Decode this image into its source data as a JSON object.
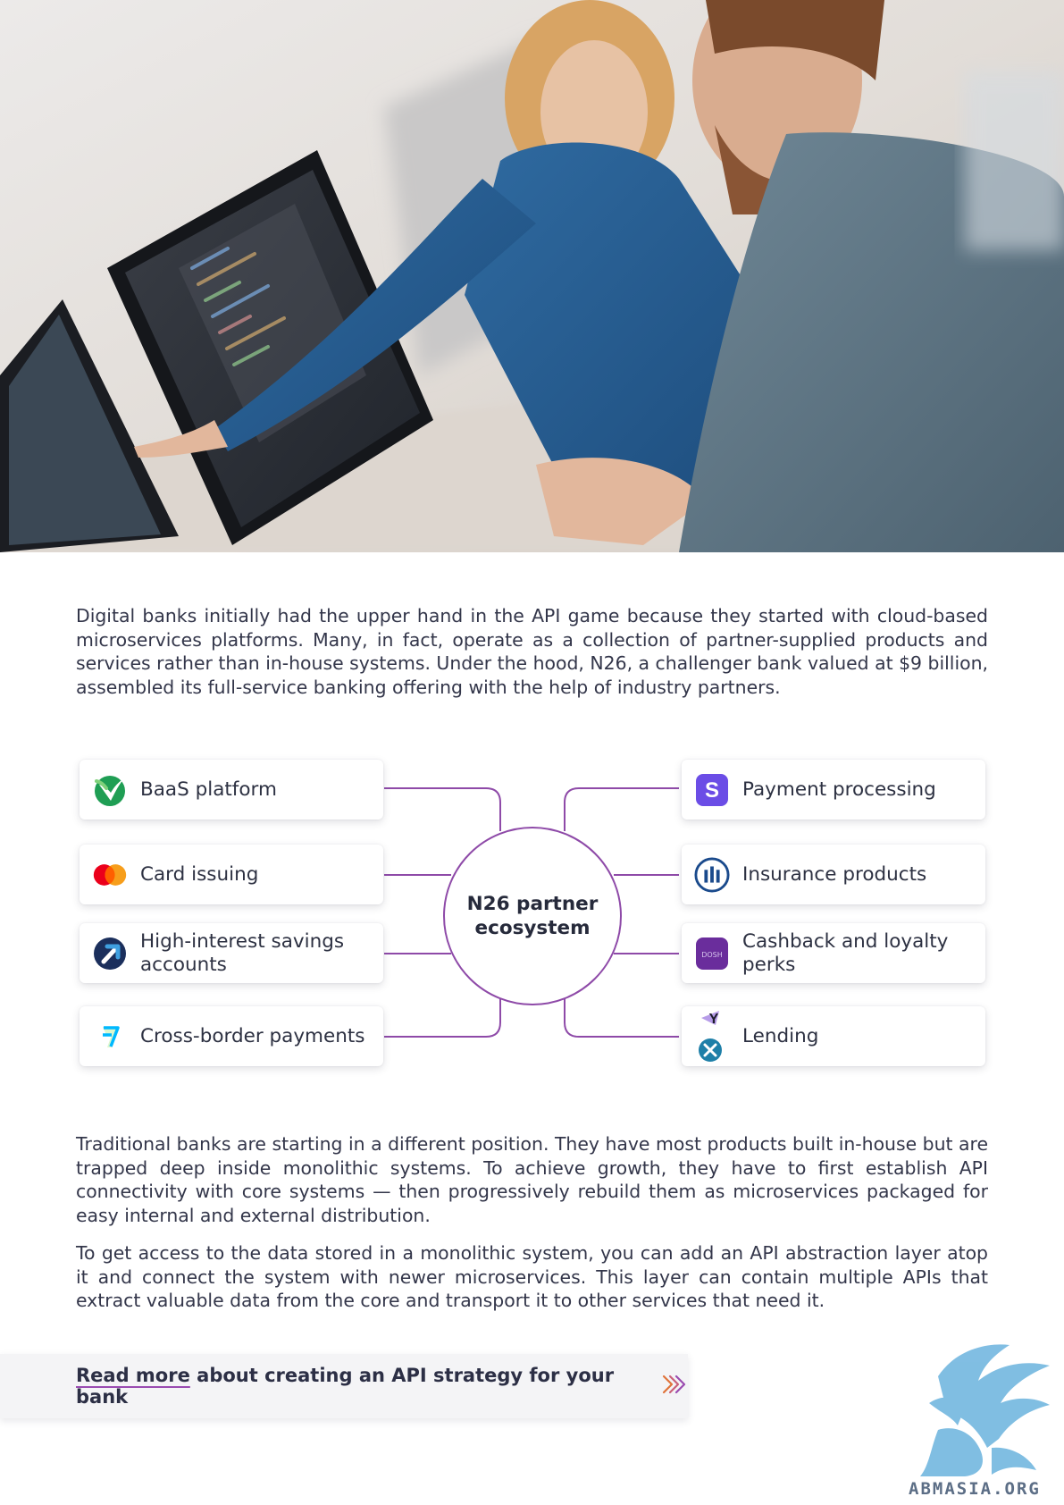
{
  "paragraphs": {
    "intro": "Digital banks initially had the upper hand in the API game because they started with cloud-based microservices platforms. Many, in fact, operate as a collection of partner-supplied products and services rather than in-house systems. Under the hood, N26, a challenger bank valued at $9 billion, assembled its full-service banking offering with the help of industry partners.",
    "traditional": "Traditional banks are starting in a different position. They have most products built in-house but are trapped deep inside monolithic systems. To achieve growth, they have to first establish API connectivity with core systems — then progressively rebuild them as microservices packaged for easy internal and external distribution.",
    "abstraction": "To get access to the data stored in a monolithic system, you can add an API abstraction layer atop it and connect the system with newer microservices. This layer can contain multiple APIs that extract valuable data from the core and transport it to other services that need it."
  },
  "ecosystem": {
    "hub": "N26 partner ecosystem",
    "left": [
      {
        "label": "BaaS platform",
        "icon": "green-check-logo-icon"
      },
      {
        "label": "Card issuing",
        "icon": "mastercard-circles-icon"
      },
      {
        "label": "High-interest savings accounts",
        "icon": "raisin-arrow-icon"
      },
      {
        "label": "Cross-border payments",
        "icon": "wise-flag-icon"
      }
    ],
    "right": [
      {
        "label": "Payment processing",
        "icon": "s-logo-icon"
      },
      {
        "label": "Insurance products",
        "icon": "allianz-logo-icon"
      },
      {
        "label": "Cashback and loyalty perks",
        "icon": "dosh-logo-icon"
      },
      {
        "label": "Lending",
        "icon": "lending-logos-icon"
      }
    ]
  },
  "icons": {
    "baas_text": "",
    "payment_letter": "S",
    "dosh_text": "DOSH",
    "lending_top": "Y"
  },
  "read_more": {
    "link": "Read more",
    "rest": " about creating an API strategy for your bank"
  },
  "watermark": "ABMASIA.ORG",
  "colors": {
    "accent": "#8e4aa8",
    "text": "#2d3142",
    "arrow": "#e0733a"
  }
}
